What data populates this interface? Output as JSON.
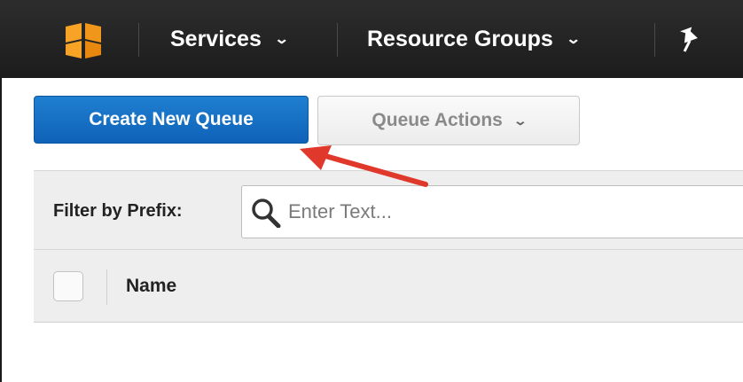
{
  "nav": {
    "services_label": "Services",
    "resource_groups_label": "Resource Groups",
    "chevron": "⌄"
  },
  "actions": {
    "create_label": "Create New Queue",
    "queue_actions_label": "Queue Actions"
  },
  "filter": {
    "label": "Filter by Prefix:",
    "placeholder": "Enter Text..."
  },
  "table": {
    "columns": [
      "Name"
    ]
  },
  "colors": {
    "nav_bg": "#232f3e",
    "logo_orange": "#f7a326",
    "primary_blue": "#1a73c8",
    "annotation_red": "#e0392b"
  },
  "icons": {
    "logo": "aws-cube-icon",
    "pin": "pin-icon",
    "search": "search-icon"
  }
}
